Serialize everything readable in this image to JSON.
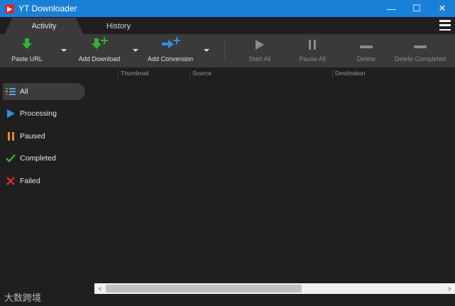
{
  "window": {
    "title": "YT Downloader",
    "minimize": "—",
    "maximize": "☐",
    "close": "✕"
  },
  "tabs": [
    {
      "label": "Activity",
      "active": true
    },
    {
      "label": "History",
      "active": false
    }
  ],
  "toolbar": {
    "paste_url": "Paste URL",
    "add_download": "Add Download",
    "add_conversion": "Add Conversion",
    "start_all": "Start All",
    "pause_all": "Pause All",
    "delete": "Delete",
    "delete_completed": "Delete Completed"
  },
  "sidebar": {
    "items": [
      {
        "label": "All",
        "icon": "list-icon",
        "color": "#4fa3e8"
      },
      {
        "label": "Processing",
        "icon": "play-icon",
        "color": "#2f8ee6"
      },
      {
        "label": "Paused",
        "icon": "pause-icon",
        "color": "#f08a24"
      },
      {
        "label": "Completed",
        "icon": "check-icon",
        "color": "#2fb52f"
      },
      {
        "label": "Failed",
        "icon": "x-icon",
        "color": "#e02828"
      }
    ]
  },
  "columns": [
    "Thumbnail",
    "Source",
    "Destination"
  ],
  "scrollbar": {
    "left": "<",
    "right": ">"
  },
  "watermark": "大数跨境",
  "colors": {
    "titlebar": "#1a7fd6",
    "toolbar": "#3a3a3a",
    "background": "#1f1f1f",
    "accent_green": "#2fb52f",
    "accent_blue": "#2f8ee6"
  }
}
